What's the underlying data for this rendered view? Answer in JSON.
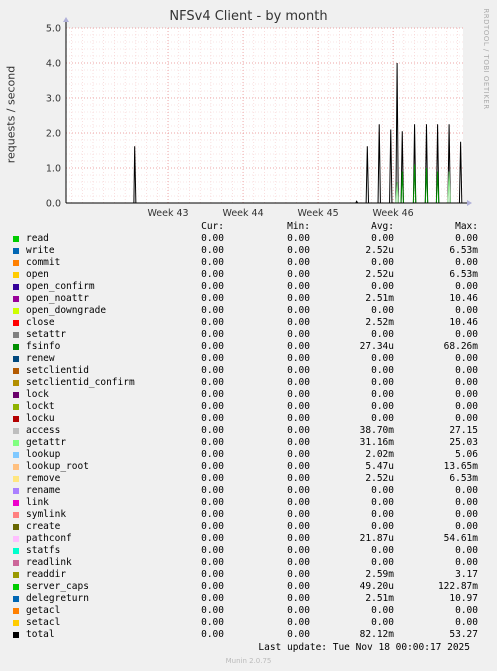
{
  "title": "NFSv4 Client - by month",
  "ylabel": "requests / second",
  "side_label": "RRDTOOL / TOBI OETIKER",
  "last_update": "Last update: Tue Nov 18 00:00:17 2025",
  "version": "Munin 2.0.75",
  "columns": {
    "cur": "Cur:",
    "min": "Min:",
    "avg": "Avg:",
    "max": "Max:"
  },
  "chart_data": {
    "type": "line",
    "title": "NFSv4 Client - by month",
    "ylabel": "requests / second",
    "ylim": [
      0,
      5
    ],
    "yticks": [
      "0.0",
      "1.0",
      "2.0",
      "3.0",
      "4.0",
      "5.0"
    ],
    "xlim": [
      0,
      100
    ],
    "xticks": [
      {
        "label": "Week 43",
        "x": 25.7
      },
      {
        "label": "Week 44",
        "x": 44.6
      },
      {
        "label": "Week 45",
        "x": 63.5
      },
      {
        "label": "Week 46",
        "x": 82.4
      }
    ],
    "grid": true,
    "series": [
      {
        "name": "total",
        "color": "#000000",
        "points": [
          [
            17.1,
            0
          ],
          [
            17.3,
            1.62
          ],
          [
            17.6,
            0
          ],
          [
            73.0,
            0
          ],
          [
            73.2,
            0.05
          ],
          [
            73.5,
            0
          ],
          [
            75.6,
            0
          ],
          [
            75.9,
            1.62
          ],
          [
            76.2,
            0
          ],
          [
            78.6,
            0
          ],
          [
            78.9,
            2.25
          ],
          [
            79.2,
            0
          ],
          [
            81.5,
            0
          ],
          [
            81.8,
            2.1
          ],
          [
            82.1,
            0
          ],
          [
            83.1,
            0
          ],
          [
            83.4,
            4.0
          ],
          [
            83.7,
            0
          ],
          [
            84.4,
            0
          ],
          [
            84.7,
            2.05
          ],
          [
            85.0,
            0
          ],
          [
            87.5,
            0
          ],
          [
            87.8,
            2.25
          ],
          [
            88.1,
            0
          ],
          [
            90.5,
            0
          ],
          [
            90.8,
            2.25
          ],
          [
            91.1,
            0
          ],
          [
            93.3,
            0
          ],
          [
            93.6,
            2.25
          ],
          [
            93.9,
            0
          ],
          [
            96.2,
            0
          ],
          [
            96.5,
            2.25
          ],
          [
            96.8,
            0
          ],
          [
            99.1,
            0
          ],
          [
            99.4,
            1.75
          ],
          [
            99.7,
            0
          ]
        ]
      },
      {
        "name": "getattr",
        "color": "#8ae68a",
        "points": [
          [
            83.1,
            0
          ],
          [
            83.4,
            0.6
          ],
          [
            83.7,
            0
          ],
          [
            96.2,
            0
          ],
          [
            96.5,
            0.9
          ],
          [
            96.8,
            0
          ]
        ]
      },
      {
        "name": "fsinfo",
        "color": "#008f00",
        "points": [
          [
            84.4,
            0
          ],
          [
            84.7,
            0.9
          ],
          [
            85.0,
            0
          ],
          [
            87.5,
            0
          ],
          [
            87.8,
            1.1
          ],
          [
            88.1,
            0
          ],
          [
            90.5,
            0
          ],
          [
            90.8,
            1.0
          ],
          [
            91.1,
            0
          ],
          [
            93.3,
            0
          ],
          [
            93.6,
            0.9
          ],
          [
            93.9,
            0
          ]
        ]
      }
    ]
  },
  "legend": [
    {
      "name": "read",
      "color": "#00cc00",
      "cur": "0.00",
      "min": "0.00",
      "avg": "0.00",
      "max": "0.00"
    },
    {
      "name": "write",
      "color": "#0066b3",
      "cur": "0.00",
      "min": "0.00",
      "avg": "2.52u",
      "max": "6.53m"
    },
    {
      "name": "commit",
      "color": "#ff8000",
      "cur": "0.00",
      "min": "0.00",
      "avg": "0.00",
      "max": "0.00"
    },
    {
      "name": "open",
      "color": "#ffcc00",
      "cur": "0.00",
      "min": "0.00",
      "avg": "2.52u",
      "max": "6.53m"
    },
    {
      "name": "open_confirm",
      "color": "#330099",
      "cur": "0.00",
      "min": "0.00",
      "avg": "0.00",
      "max": "0.00"
    },
    {
      "name": "open_noattr",
      "color": "#990099",
      "cur": "0.00",
      "min": "0.00",
      "avg": "2.51m",
      "max": "10.46"
    },
    {
      "name": "open_downgrade",
      "color": "#ccff00",
      "cur": "0.00",
      "min": "0.00",
      "avg": "0.00",
      "max": "0.00"
    },
    {
      "name": "close",
      "color": "#ff0000",
      "cur": "0.00",
      "min": "0.00",
      "avg": "2.52m",
      "max": "10.46"
    },
    {
      "name": "setattr",
      "color": "#808080",
      "cur": "0.00",
      "min": "0.00",
      "avg": "0.00",
      "max": "0.00"
    },
    {
      "name": "fsinfo",
      "color": "#008f00",
      "cur": "0.00",
      "min": "0.00",
      "avg": "27.34u",
      "max": "68.26m"
    },
    {
      "name": "renew",
      "color": "#00487d",
      "cur": "0.00",
      "min": "0.00",
      "avg": "0.00",
      "max": "0.00"
    },
    {
      "name": "setclientid",
      "color": "#b35a00",
      "cur": "0.00",
      "min": "0.00",
      "avg": "0.00",
      "max": "0.00"
    },
    {
      "name": "setclientid_confirm",
      "color": "#b38f00",
      "cur": "0.00",
      "min": "0.00",
      "avg": "0.00",
      "max": "0.00"
    },
    {
      "name": "lock",
      "color": "#6b006b",
      "cur": "0.00",
      "min": "0.00",
      "avg": "0.00",
      "max": "0.00"
    },
    {
      "name": "lockt",
      "color": "#8fb300",
      "cur": "0.00",
      "min": "0.00",
      "avg": "0.00",
      "max": "0.00"
    },
    {
      "name": "locku",
      "color": "#b30000",
      "cur": "0.00",
      "min": "0.00",
      "avg": "0.00",
      "max": "0.00"
    },
    {
      "name": "access",
      "color": "#bebebe",
      "cur": "0.00",
      "min": "0.00",
      "avg": "38.70m",
      "max": "27.15"
    },
    {
      "name": "getattr",
      "color": "#80ff80",
      "cur": "0.00",
      "min": "0.00",
      "avg": "31.16m",
      "max": "25.03"
    },
    {
      "name": "lookup",
      "color": "#80c9ff",
      "cur": "0.00",
      "min": "0.00",
      "avg": "2.02m",
      "max": "5.06"
    },
    {
      "name": "lookup_root",
      "color": "#ffc080",
      "cur": "0.00",
      "min": "0.00",
      "avg": "5.47u",
      "max": "13.65m"
    },
    {
      "name": "remove",
      "color": "#ffe680",
      "cur": "0.00",
      "min": "0.00",
      "avg": "2.52u",
      "max": "6.53m"
    },
    {
      "name": "rename",
      "color": "#aa80ff",
      "cur": "0.00",
      "min": "0.00",
      "avg": "0.00",
      "max": "0.00"
    },
    {
      "name": "link",
      "color": "#ee00cc",
      "cur": "0.00",
      "min": "0.00",
      "avg": "0.00",
      "max": "0.00"
    },
    {
      "name": "symlink",
      "color": "#ff8080",
      "cur": "0.00",
      "min": "0.00",
      "avg": "0.00",
      "max": "0.00"
    },
    {
      "name": "create",
      "color": "#666600",
      "cur": "0.00",
      "min": "0.00",
      "avg": "0.00",
      "max": "0.00"
    },
    {
      "name": "pathconf",
      "color": "#ffbfff",
      "cur": "0.00",
      "min": "0.00",
      "avg": "21.87u",
      "max": "54.61m"
    },
    {
      "name": "statfs",
      "color": "#00ffcc",
      "cur": "0.00",
      "min": "0.00",
      "avg": "0.00",
      "max": "0.00"
    },
    {
      "name": "readlink",
      "color": "#cc6699",
      "cur": "0.00",
      "min": "0.00",
      "avg": "0.00",
      "max": "0.00"
    },
    {
      "name": "readdir",
      "color": "#999900",
      "cur": "0.00",
      "min": "0.00",
      "avg": "2.59m",
      "max": "3.17"
    },
    {
      "name": "server_caps",
      "color": "#00cc00",
      "cur": "0.00",
      "min": "0.00",
      "avg": "49.20u",
      "max": "122.87m"
    },
    {
      "name": "delegreturn",
      "color": "#0066b3",
      "cur": "0.00",
      "min": "0.00",
      "avg": "2.51m",
      "max": "10.97"
    },
    {
      "name": "getacl",
      "color": "#ff8000",
      "cur": "0.00",
      "min": "0.00",
      "avg": "0.00",
      "max": "0.00"
    },
    {
      "name": "setacl",
      "color": "#ffcc00",
      "cur": "0.00",
      "min": "0.00",
      "avg": "0.00",
      "max": "0.00"
    },
    {
      "name": "total",
      "color": "#000000",
      "cur": "0.00",
      "min": "0.00",
      "avg": "82.12m",
      "max": "53.27"
    }
  ]
}
